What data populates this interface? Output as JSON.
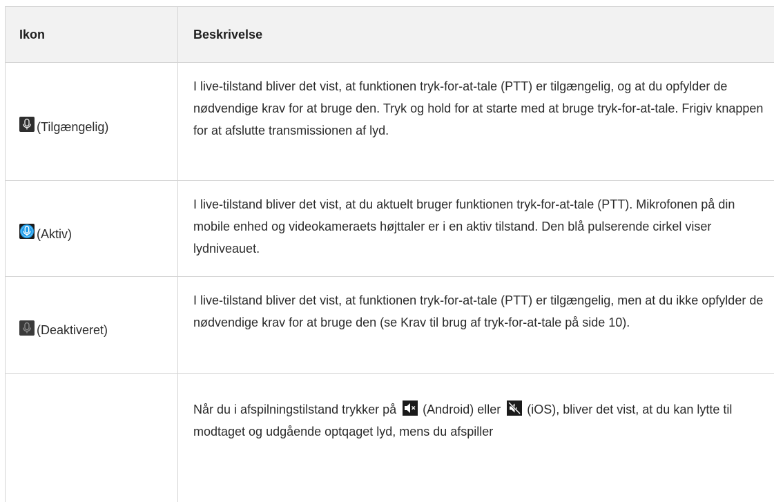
{
  "table": {
    "headers": {
      "icon": "Ikon",
      "description": "Beskrivelse"
    },
    "rows": [
      {
        "icon_name": "microphone-available-icon",
        "icon_label": "(Tilgængelig)",
        "description": "I live-tilstand bliver det vist, at funktionen tryk-for-at-tale (PTT) er tilgængelig, og at du opfylder de nødvendige krav for at bruge den. Tryk og hold for at starte med at bruge tryk-for-at-tale. Frigiv knappen for at afslutte transmissionen af lyd."
      },
      {
        "icon_name": "microphone-active-icon",
        "icon_label": "(Aktiv)",
        "description": "I live-tilstand bliver det vist, at du aktuelt bruger funktionen tryk-for-at-tale (PTT). Mikrofonen på din mobile enhed og videokameraets højttaler er i en aktiv tilstand. Den blå pulserende cirkel viser lydniveauet."
      },
      {
        "icon_name": "microphone-disabled-icon",
        "icon_label": "(Deaktiveret)",
        "description": "I live-tilstand bliver det vist, at funktionen tryk-for-at-tale (PTT) er tilgængelig, men at du ikke opfylder de nødvendige krav for at bruge den (se Krav til brug af tryk-for-at-tale på side 10)."
      },
      {
        "icon_name": "",
        "icon_label": "",
        "description_part1": "Når du i afspilningstilstand trykker på",
        "android_icon": "speaker-muted-android-icon",
        "description_part2": "(Android) eller",
        "ios_icon": "speaker-muted-ios-icon",
        "description_part3": "(iOS), bliver det vist, at du kan lytte til modtaget og udgående optqaget lyd, mens du afspiller"
      }
    ]
  },
  "colors": {
    "header_bg": "#f2f2f2",
    "border": "#d4d4d4",
    "mic_available_bg": "#2e2e2e",
    "mic_active_bg": "#1e9be8",
    "mic_disabled_bg": "#3a3a3a"
  }
}
